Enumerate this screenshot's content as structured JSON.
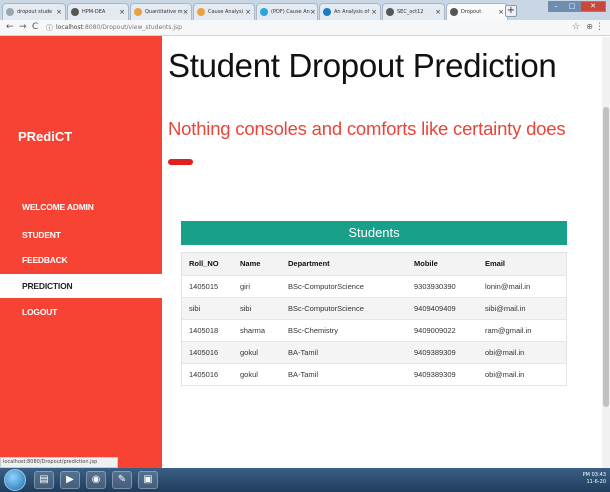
{
  "browser": {
    "tabs": [
      {
        "label": "dropout stude",
        "color": "#9aa6b2"
      },
      {
        "label": "HPM-DEA",
        "color": "#555"
      },
      {
        "label": "Quantitative m",
        "color": "#e8a33d"
      },
      {
        "label": "Cause Analysi",
        "color": "#e8a33d"
      },
      {
        "label": "(PDF) Cause An",
        "color": "#27a6e0"
      },
      {
        "label": "An Analysis of",
        "color": "#1b7dbf"
      },
      {
        "label": "SEC_oct12",
        "color": "#555"
      },
      {
        "label": "Dropout",
        "color": "#555"
      }
    ],
    "url_host": "localhost",
    "url_path": ":8080/Dropout/view_students.jsp",
    "status_url": "localhost:8080/Dropout/prediction.jsp"
  },
  "sidebar": {
    "logo": "PRediCT",
    "items": [
      {
        "label": "WELCOME ADMIN",
        "active": false
      },
      {
        "label": "STUDENT",
        "active": false
      },
      {
        "label": "FEEDBACK",
        "active": false
      },
      {
        "label": "PREDICTION",
        "active": true
      },
      {
        "label": "LOGOUT",
        "active": false
      }
    ]
  },
  "page": {
    "title": "Student Dropout Prediction",
    "tagline": "Nothing consoles and comforts like certainty does",
    "accent": "#f74334",
    "heading_color": "#e8453a"
  },
  "students": {
    "heading": "Students",
    "header_color": "#19a08a",
    "columns": [
      "Roll_NO",
      "Name",
      "Department",
      "Mobile",
      "Email"
    ],
    "rows": [
      [
        "1405015",
        "giri",
        "BSc-ComputorScience",
        "9303930390",
        "lonin@mail.in"
      ],
      [
        "sibi",
        "sibi",
        "BSc-ComputorScience",
        "9409409409",
        "sibi@mail.in"
      ],
      [
        "1405018",
        "sharma",
        "BSc-Chemistry",
        "9409009022",
        "ram@gmail.in"
      ],
      [
        "1405016",
        "gokul",
        "BA-Tamil",
        "9409389309",
        "obi@mail.in"
      ],
      [
        "1405016",
        "gokul",
        "BA-Tamil",
        "9409389309",
        "obi@mail.in"
      ]
    ]
  },
  "taskbar": {
    "time": "PM 03:43",
    "date": "11-6-20"
  }
}
